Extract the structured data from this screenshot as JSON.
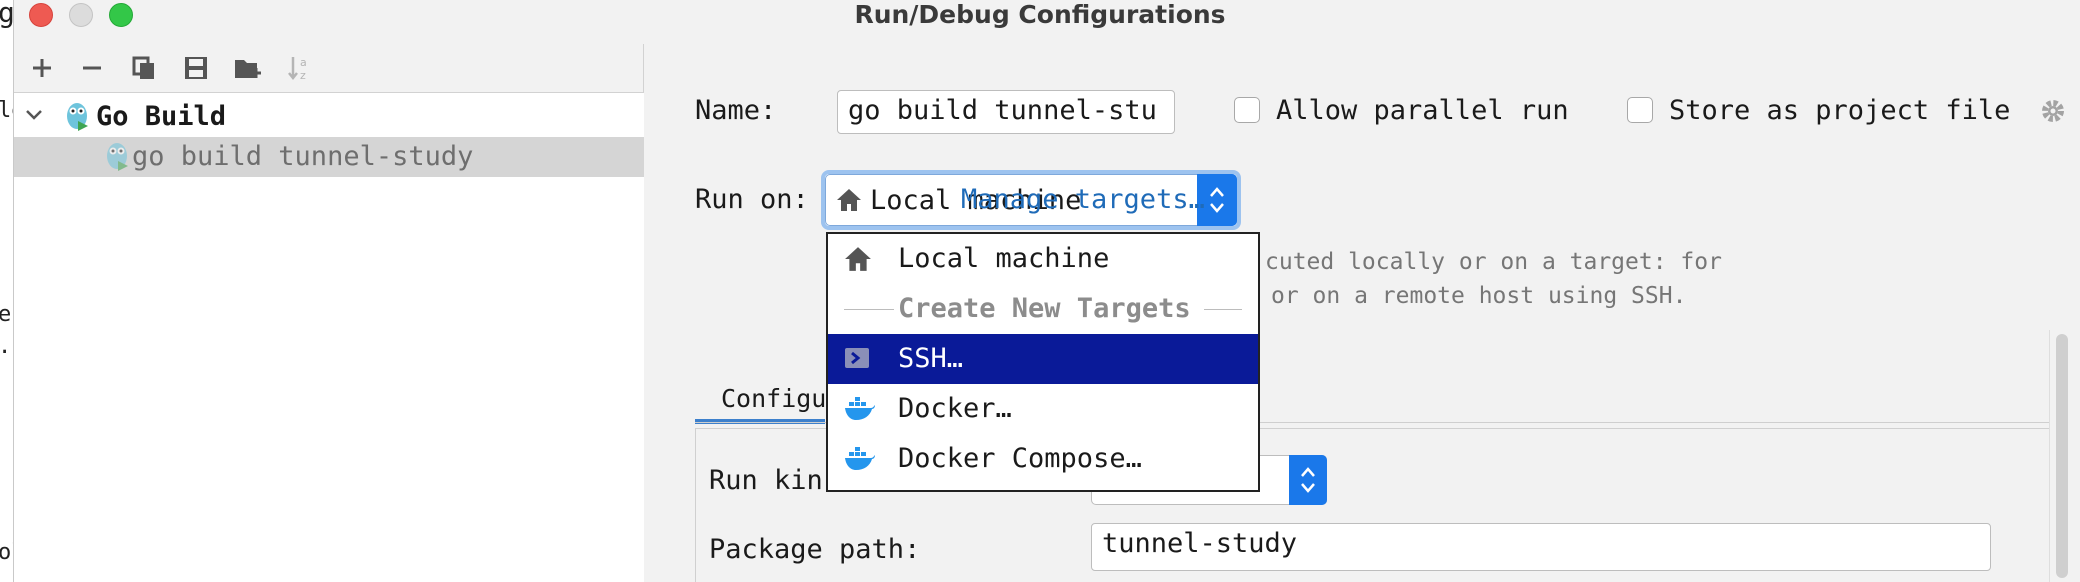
{
  "window": {
    "title": "Run/Debug Configurations"
  },
  "background_window": {
    "fragments": [
      "g",
      "le",
      "e",
      ".",
      "ol"
    ]
  },
  "toolbar": {
    "buttons": [
      "add-icon",
      "remove-icon",
      "copy-icon",
      "save-icon",
      "new-folder-icon",
      "sort-icon"
    ]
  },
  "tree": {
    "group": {
      "label": "Go Build",
      "icon": "go-gopher-icon"
    },
    "items": [
      {
        "label": "go build tunnel-study",
        "icon": "go-gopher-icon"
      }
    ]
  },
  "form": {
    "name_label": "Name:",
    "name_value": "go build tunnel-stu",
    "allow_parallel_label": "Allow parallel run",
    "allow_parallel_checked": false,
    "store_project_label": "Store as project file",
    "store_project_checked": false,
    "run_on_label": "Run on:",
    "run_on_value": "Local machine",
    "manage_targets_link": "Manage targets…",
    "hint_line1": "cuted locally or on a target: for",
    "hint_line2": "or on a remote host using SSH.",
    "tab_label": "Configu",
    "run_kind_label": "Run kin",
    "package_path_label": "Package path:",
    "package_path_value": "tunnel-study"
  },
  "dropdown": {
    "items": [
      {
        "label": "Local machine",
        "icon": "home-icon",
        "selected": false
      },
      {
        "label": "SSH…",
        "icon": "ssh-terminal-icon",
        "selected": true
      },
      {
        "label": "Docker…",
        "icon": "docker-icon",
        "selected": false
      },
      {
        "label": "Docker Compose…",
        "icon": "docker-icon",
        "selected": false
      }
    ],
    "section_header": "Create New Targets"
  },
  "colors": {
    "selection": "#0a1a98",
    "link": "#1f6bb8",
    "combo_arrow": "#1a78ea",
    "docker_blue": "#2496ed"
  }
}
